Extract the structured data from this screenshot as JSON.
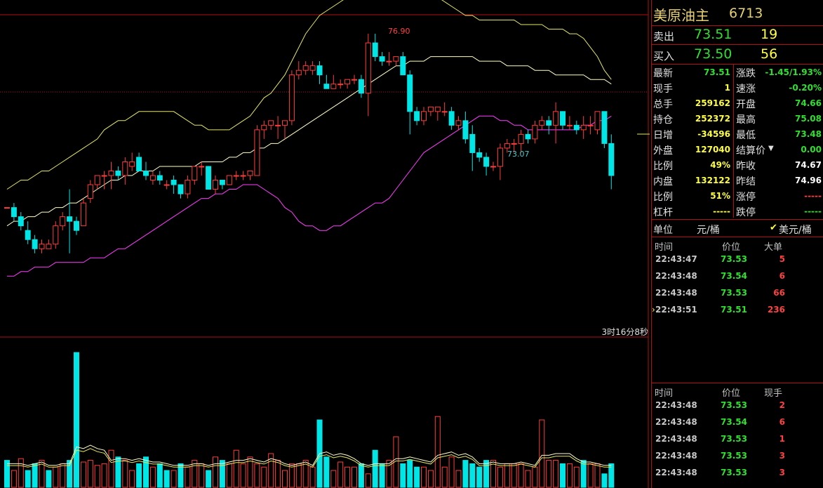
{
  "chart": {
    "high_label": "76.90",
    "low_label": "73.07",
    "countdown": "3时16分8秒",
    "colors": {
      "up": "#ff3c3c",
      "down": "#00e5e5",
      "upper_band": "#e6e664",
      "middle_band": "#ffffc8",
      "lower_band": "#ff3cff"
    }
  },
  "chart_data": {
    "type": "candlestick",
    "price_range": [
      70.3,
      77.3
    ],
    "candles": [
      [
        73.1,
        73.2,
        73.2,
        73.1
      ],
      [
        73.1,
        73.2,
        72.8,
        72.9
      ],
      [
        72.9,
        73.0,
        72.6,
        72.7
      ],
      [
        72.6,
        72.8,
        72.3,
        72.4
      ],
      [
        72.4,
        72.5,
        72.1,
        72.2
      ],
      [
        72.2,
        72.4,
        72.1,
        72.3
      ],
      [
        72.2,
        72.4,
        72.2,
        72.3
      ],
      [
        72.3,
        72.8,
        72.2,
        72.7
      ],
      [
        72.7,
        73.0,
        72.6,
        72.9
      ],
      [
        72.9,
        73.5,
        72.1,
        72.8
      ],
      [
        72.8,
        72.9,
        72.5,
        72.6
      ],
      [
        72.7,
        73.3,
        72.7,
        73.2
      ],
      [
        73.3,
        73.7,
        73.2,
        73.6
      ],
      [
        73.6,
        73.8,
        73.5,
        73.8
      ],
      [
        73.8,
        73.9,
        73.5,
        73.8
      ],
      [
        73.8,
        74.1,
        73.5,
        73.9
      ],
      [
        73.9,
        74.0,
        73.7,
        73.8
      ],
      [
        73.8,
        74.2,
        73.6,
        74.1
      ],
      [
        74.0,
        74.3,
        73.9,
        74.1
      ],
      [
        74.2,
        74.3,
        73.9,
        73.9
      ],
      [
        73.9,
        74.1,
        73.7,
        73.8
      ],
      [
        73.7,
        73.9,
        73.6,
        73.8
      ],
      [
        73.8,
        73.9,
        73.6,
        73.7
      ],
      [
        73.6,
        73.7,
        73.5,
        73.6
      ],
      [
        73.7,
        73.8,
        73.4,
        73.6
      ],
      [
        73.6,
        73.6,
        73.3,
        73.4
      ],
      [
        73.4,
        73.8,
        73.3,
        73.7
      ],
      [
        73.7,
        74.0,
        73.6,
        74.0
      ],
      [
        74.0,
        74.1,
        73.8,
        74.0
      ],
      [
        74.0,
        74.0,
        73.5,
        73.5
      ],
      [
        73.5,
        73.8,
        73.4,
        73.7
      ],
      [
        73.7,
        73.7,
        73.5,
        73.6
      ],
      [
        73.6,
        73.8,
        73.6,
        73.8
      ],
      [
        73.8,
        73.9,
        73.7,
        73.8
      ],
      [
        73.8,
        73.9,
        73.7,
        73.8
      ],
      [
        73.8,
        73.9,
        73.7,
        73.9
      ],
      [
        73.8,
        74.9,
        73.8,
        74.8
      ],
      [
        74.8,
        75.0,
        74.6,
        74.9
      ],
      [
        74.9,
        75.0,
        74.8,
        75.0
      ],
      [
        74.9,
        75.1,
        74.6,
        74.9
      ],
      [
        74.9,
        75.0,
        74.6,
        75.0
      ],
      [
        75.0,
        76.1,
        74.9,
        76.0
      ],
      [
        76.0,
        76.3,
        75.9,
        76.1
      ],
      [
        76.1,
        76.3,
        76.0,
        76.2
      ],
      [
        76.1,
        76.3,
        76.0,
        76.2
      ],
      [
        76.2,
        76.3,
        75.8,
        76.0
      ],
      [
        75.8,
        76.0,
        75.7,
        75.7
      ],
      [
        75.7,
        76.0,
        75.7,
        75.8
      ],
      [
        75.8,
        75.9,
        75.7,
        75.8
      ],
      [
        75.8,
        75.9,
        75.7,
        75.9
      ],
      [
        75.9,
        76.0,
        75.8,
        75.9
      ],
      [
        75.9,
        76.0,
        75.5,
        75.6
      ],
      [
        75.6,
        76.9,
        75.1,
        76.7
      ],
      [
        76.7,
        76.9,
        76.3,
        76.4
      ],
      [
        76.4,
        76.5,
        76.2,
        76.3
      ],
      [
        76.3,
        76.5,
        76.2,
        76.3
      ],
      [
        76.3,
        76.4,
        76.2,
        76.4
      ],
      [
        76.4,
        76.5,
        76.0,
        76.0
      ],
      [
        76.0,
        76.1,
        74.7,
        75.2
      ],
      [
        75.2,
        75.3,
        74.9,
        75.0
      ],
      [
        75.0,
        75.3,
        74.9,
        75.2
      ],
      [
        75.2,
        75.3,
        75.1,
        75.3
      ],
      [
        75.2,
        75.3,
        75.0,
        75.3
      ],
      [
        75.2,
        75.4,
        75.1,
        75.2
      ],
      [
        75.2,
        75.3,
        74.8,
        74.9
      ],
      [
        74.9,
        75.1,
        74.8,
        75.0
      ],
      [
        75.0,
        75.2,
        74.5,
        74.6
      ],
      [
        74.7,
        74.9,
        73.9,
        74.3
      ],
      [
        74.3,
        74.4,
        74.1,
        74.2
      ],
      [
        74.2,
        74.3,
        73.8,
        74.0
      ],
      [
        74.0,
        74.1,
        73.9,
        74.0
      ],
      [
        74.0,
        74.5,
        73.7,
        74.4
      ],
      [
        74.4,
        74.6,
        74.3,
        74.5
      ],
      [
        74.5,
        74.6,
        74.3,
        74.5
      ],
      [
        74.5,
        74.8,
        74.3,
        74.7
      ],
      [
        74.7,
        74.8,
        74.5,
        74.6
      ],
      [
        74.6,
        75.0,
        74.5,
        74.9
      ],
      [
        74.9,
        75.1,
        74.8,
        75.0
      ],
      [
        75.0,
        75.1,
        74.7,
        74.9
      ],
      [
        74.9,
        75.4,
        74.5,
        75.2
      ],
      [
        75.2,
        75.2,
        74.8,
        74.9
      ],
      [
        74.9,
        75.1,
        74.8,
        74.9
      ],
      [
        74.9,
        75.0,
        74.7,
        74.8
      ],
      [
        74.8,
        75.1,
        74.6,
        74.9
      ],
      [
        74.9,
        75.1,
        74.7,
        74.9
      ],
      [
        74.8,
        75.2,
        74.7,
        75.2
      ],
      [
        75.2,
        75.2,
        74.4,
        74.5
      ],
      [
        74.5,
        74.7,
        73.5,
        73.8
      ]
    ],
    "upper_band": [
      73.5,
      73.6,
      73.7,
      73.7,
      73.8,
      73.9,
      73.9,
      74.0,
      74.1,
      74.2,
      74.3,
      74.4,
      74.5,
      74.6,
      74.8,
      74.9,
      75.0,
      75.0,
      75.1,
      75.2,
      75.2,
      75.2,
      75.2,
      75.2,
      75.2,
      75.1,
      75.0,
      74.9,
      74.9,
      74.8,
      74.8,
      74.8,
      74.8,
      74.9,
      75.0,
      75.1,
      75.3,
      75.5,
      75.6,
      75.8,
      76.0,
      76.3,
      76.6,
      76.9,
      77.1,
      77.3,
      77.4,
      77.5,
      77.6,
      77.7,
      77.8,
      77.9,
      78.0,
      78.1,
      78.2,
      78.2,
      78.2,
      78.1,
      78.0,
      77.9,
      77.8,
      77.8,
      77.7,
      77.6,
      77.5,
      77.4,
      77.3,
      77.3,
      77.2,
      77.2,
      77.2,
      77.2,
      77.2,
      77.2,
      77.1,
      77.1,
      77.1,
      77.1,
      77.0,
      77.0,
      77.0,
      76.9,
      76.9,
      76.8,
      76.6,
      76.4,
      76.1,
      75.9
    ],
    "middle_band": [
      72.7,
      72.8,
      72.8,
      72.9,
      72.9,
      73.0,
      73.0,
      73.1,
      73.1,
      73.2,
      73.2,
      73.3,
      73.4,
      73.5,
      73.6,
      73.7,
      73.7,
      73.8,
      73.8,
      73.9,
      73.9,
      73.9,
      74.0,
      74.0,
      74.0,
      74.0,
      74.0,
      74.0,
      74.1,
      74.1,
      74.1,
      74.1,
      74.2,
      74.2,
      74.3,
      74.3,
      74.4,
      74.4,
      74.5,
      74.5,
      74.6,
      74.7,
      74.8,
      74.9,
      75.0,
      75.1,
      75.2,
      75.3,
      75.4,
      75.5,
      75.6,
      75.7,
      75.8,
      75.9,
      76.0,
      76.1,
      76.2,
      76.2,
      76.3,
      76.3,
      76.3,
      76.4,
      76.4,
      76.4,
      76.4,
      76.4,
      76.4,
      76.4,
      76.3,
      76.3,
      76.3,
      76.3,
      76.2,
      76.2,
      76.2,
      76.2,
      76.1,
      76.1,
      76.1,
      76.0,
      76.0,
      76.0,
      76.0,
      76.0,
      75.9,
      75.9,
      75.9,
      75.8
    ],
    "lower_band": [
      71.6,
      71.6,
      71.7,
      71.7,
      71.8,
      71.8,
      71.8,
      71.9,
      71.9,
      71.9,
      71.9,
      71.9,
      72.0,
      72.0,
      72.0,
      72.1,
      72.2,
      72.2,
      72.3,
      72.4,
      72.5,
      72.6,
      72.7,
      72.8,
      72.9,
      73.0,
      73.1,
      73.2,
      73.3,
      73.3,
      73.4,
      73.4,
      73.5,
      73.5,
      73.6,
      73.6,
      73.6,
      73.5,
      73.4,
      73.3,
      73.1,
      73.0,
      72.8,
      72.7,
      72.7,
      72.6,
      72.6,
      72.7,
      72.7,
      72.8,
      72.9,
      73.0,
      73.1,
      73.2,
      73.2,
      73.3,
      73.5,
      73.7,
      73.9,
      74.1,
      74.3,
      74.4,
      74.5,
      74.6,
      74.7,
      74.8,
      74.9,
      75.0,
      75.1,
      75.1,
      75.1,
      75.0,
      75.0,
      74.9,
      74.9,
      74.8,
      74.8,
      74.8,
      74.8,
      74.8,
      74.8,
      74.8,
      74.8,
      74.9,
      74.9,
      75.0,
      75.0,
      75.1
    ],
    "volumes": [
      16,
      10,
      17,
      10,
      14,
      16,
      10,
      12,
      14,
      16,
      80,
      15,
      16,
      13,
      14,
      22,
      18,
      16,
      10,
      14,
      18,
      12,
      14,
      10,
      10,
      14,
      12,
      16,
      14,
      10,
      18,
      16,
      14,
      22,
      14,
      18,
      14,
      12,
      20,
      16,
      10,
      14,
      14,
      16,
      12,
      40,
      18,
      10,
      15,
      12,
      12,
      14,
      8,
      22,
      14,
      16,
      30,
      14,
      16,
      12,
      12,
      10,
      42,
      12,
      18,
      10,
      16,
      14,
      12,
      16,
      16,
      12,
      14,
      14,
      14,
      10,
      12,
      40,
      16,
      16,
      14,
      14,
      12,
      16,
      14,
      14,
      8,
      14
    ],
    "volume_up": [
      0,
      1,
      1,
      0,
      0,
      1,
      0,
      1,
      1,
      0,
      0,
      1,
      1,
      1,
      1,
      1,
      0,
      1,
      1,
      0,
      0,
      1,
      0,
      0,
      1,
      0,
      1,
      1,
      1,
      0,
      1,
      0,
      1,
      1,
      1,
      1,
      1,
      1,
      1,
      1,
      1,
      1,
      1,
      1,
      1,
      0,
      0,
      1,
      1,
      1,
      1,
      0,
      1,
      0,
      0,
      1,
      1,
      0,
      0,
      0,
      1,
      1,
      1,
      1,
      1,
      1,
      0,
      0,
      0,
      0,
      1,
      1,
      1,
      1,
      1,
      1,
      1,
      1,
      1,
      1,
      0,
      1,
      1,
      0,
      1,
      1,
      0,
      0
    ],
    "volume_ma5": [
      14,
      14,
      14,
      13,
      14,
      15,
      13,
      13,
      14,
      14,
      24,
      23,
      25,
      23,
      22,
      16,
      17,
      17,
      16,
      17,
      16,
      15,
      15,
      14,
      13,
      13,
      13,
      14,
      14,
      13,
      14,
      14,
      15,
      16,
      16,
      17,
      16,
      15,
      17,
      16,
      14,
      13,
      14,
      15,
      13,
      20,
      21,
      19,
      20,
      19,
      17,
      14,
      13,
      14,
      14,
      14,
      17,
      17,
      18,
      17,
      16,
      15,
      19,
      20,
      21,
      19,
      20,
      18,
      14,
      14,
      15,
      14,
      14,
      14,
      15,
      14,
      13,
      19,
      19,
      20,
      20,
      20,
      17,
      15,
      15,
      14,
      13,
      13
    ]
  },
  "panel": {
    "title_name": "美原油主",
    "title_code": "6713",
    "sell": {
      "label": "卖出",
      "price": "73.51",
      "volume": "19"
    },
    "buy": {
      "label": "买入",
      "price": "73.50",
      "volume": "56"
    },
    "stats_left": [
      {
        "label": "最新",
        "value": "73.51",
        "color": "#30e030"
      },
      {
        "label": "现手",
        "value": "1",
        "color": "#ffff40"
      },
      {
        "label": "总手",
        "value": "259162",
        "color": "#ffff40"
      },
      {
        "label": "持仓",
        "value": "252372",
        "color": "#ffff40"
      },
      {
        "label": "日增",
        "value": "-34596",
        "color": "#ffff40"
      },
      {
        "label": "外盘",
        "value": "127040",
        "color": "#ffff40"
      },
      {
        "label": "比例",
        "value": "49%",
        "color": "#ffff40"
      },
      {
        "label": "内盘",
        "value": "132122",
        "color": "#ffff40"
      },
      {
        "label": "比例",
        "value": "51%",
        "color": "#ffff40"
      },
      {
        "label": "杠杆",
        "value": "-----",
        "color": "#ffff40"
      }
    ],
    "stats_right": [
      {
        "label": "涨跌",
        "value": "-1.45/1.93%",
        "color": "#30e030"
      },
      {
        "label": "速涨",
        "value": "-0.20%",
        "color": "#30e030"
      },
      {
        "label": "开盘",
        "value": "74.66",
        "color": "#30e030"
      },
      {
        "label": "最高",
        "value": "75.08",
        "color": "#30e030"
      },
      {
        "label": "最低",
        "value": "73.48",
        "color": "#30e030"
      },
      {
        "label": "结算价",
        "value": "0.00",
        "color": "#30e030",
        "dropdown": true
      },
      {
        "label": "昨收",
        "value": "74.67",
        "color": "#ffffff"
      },
      {
        "label": "昨结",
        "value": "74.96",
        "color": "#ffffff"
      },
      {
        "label": "涨停",
        "value": "-----",
        "color": "#ff4040"
      },
      {
        "label": "跌停",
        "value": "-----",
        "color": "#30e030"
      }
    ],
    "unit": {
      "label": "单位",
      "option1": "元/桶",
      "option2": "美元/桶",
      "check": "✔"
    },
    "big_orders": {
      "headers": [
        "时间",
        "价位",
        "大单"
      ],
      "rows": [
        {
          "time": "22:43:47",
          "price": "73.53",
          "vol": "5"
        },
        {
          "time": "22:43:48",
          "price": "73.54",
          "vol": "6"
        },
        {
          "time": "22:43:48",
          "price": "73.53",
          "vol": "66"
        },
        {
          "time": "22:43:51",
          "price": "73.51",
          "vol": "236"
        }
      ]
    },
    "ticks": {
      "headers": [
        "时间",
        "价位",
        "现手"
      ],
      "rows": [
        {
          "time": "22:43:48",
          "price": "73.53",
          "vol": "2"
        },
        {
          "time": "22:43:48",
          "price": "73.54",
          "vol": "6"
        },
        {
          "time": "22:43:48",
          "price": "73.53",
          "vol": "1"
        },
        {
          "time": "22:43:48",
          "price": "73.53",
          "vol": "3"
        },
        {
          "time": "22:43:48",
          "price": "73.53",
          "vol": "3"
        }
      ]
    }
  }
}
